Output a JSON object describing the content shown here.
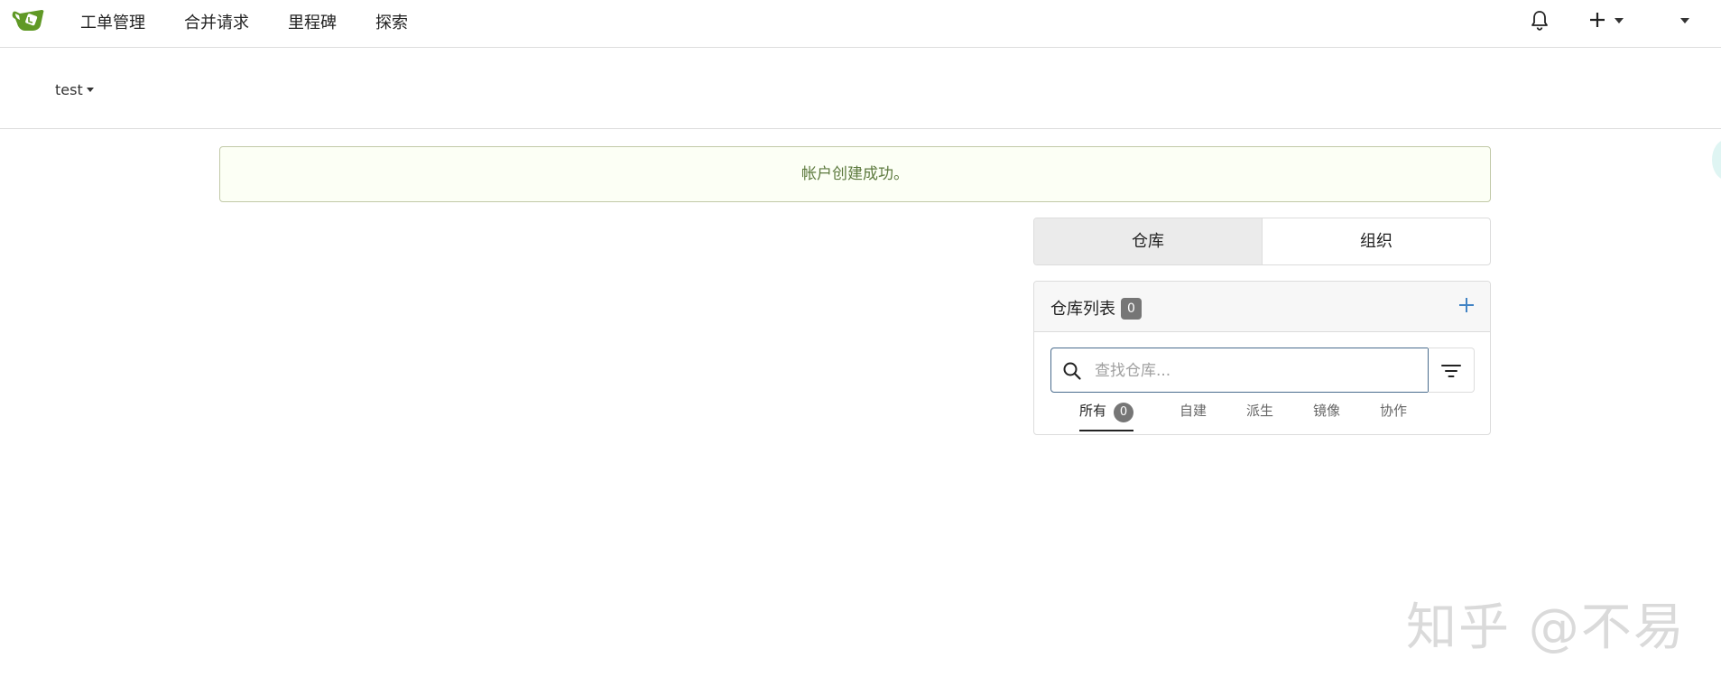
{
  "navbar": {
    "logo": "gitea-logo",
    "items": [
      {
        "label": "工单管理"
      },
      {
        "label": "合并请求"
      },
      {
        "label": "里程碑"
      },
      {
        "label": "探索"
      }
    ],
    "icons": {
      "notifications": "bell-icon",
      "create": "plus-icon",
      "user_menu": "caret-down-icon"
    }
  },
  "user": {
    "name": "test"
  },
  "flash": {
    "message": "帐户创建成功。"
  },
  "switch": {
    "tabs": [
      {
        "label": "仓库",
        "active": true
      },
      {
        "label": "组织",
        "active": false
      }
    ]
  },
  "repo_panel": {
    "title": "仓库列表",
    "count": "0",
    "add_icon": "plus-icon",
    "search": {
      "placeholder": "查找仓库..."
    },
    "filter_icon": "filter-icon",
    "tabs": [
      {
        "label": "所有",
        "count": "0",
        "active": true
      },
      {
        "label": "自建"
      },
      {
        "label": "派生"
      },
      {
        "label": "镜像"
      },
      {
        "label": "协作"
      }
    ]
  },
  "watermark": "知乎 @不易",
  "colors": {
    "success_bg": "#fcfff5",
    "success_text": "#5d7a3e",
    "badge": "#767676",
    "accent": "#4a6c8d",
    "logo_green": "#609926"
  }
}
